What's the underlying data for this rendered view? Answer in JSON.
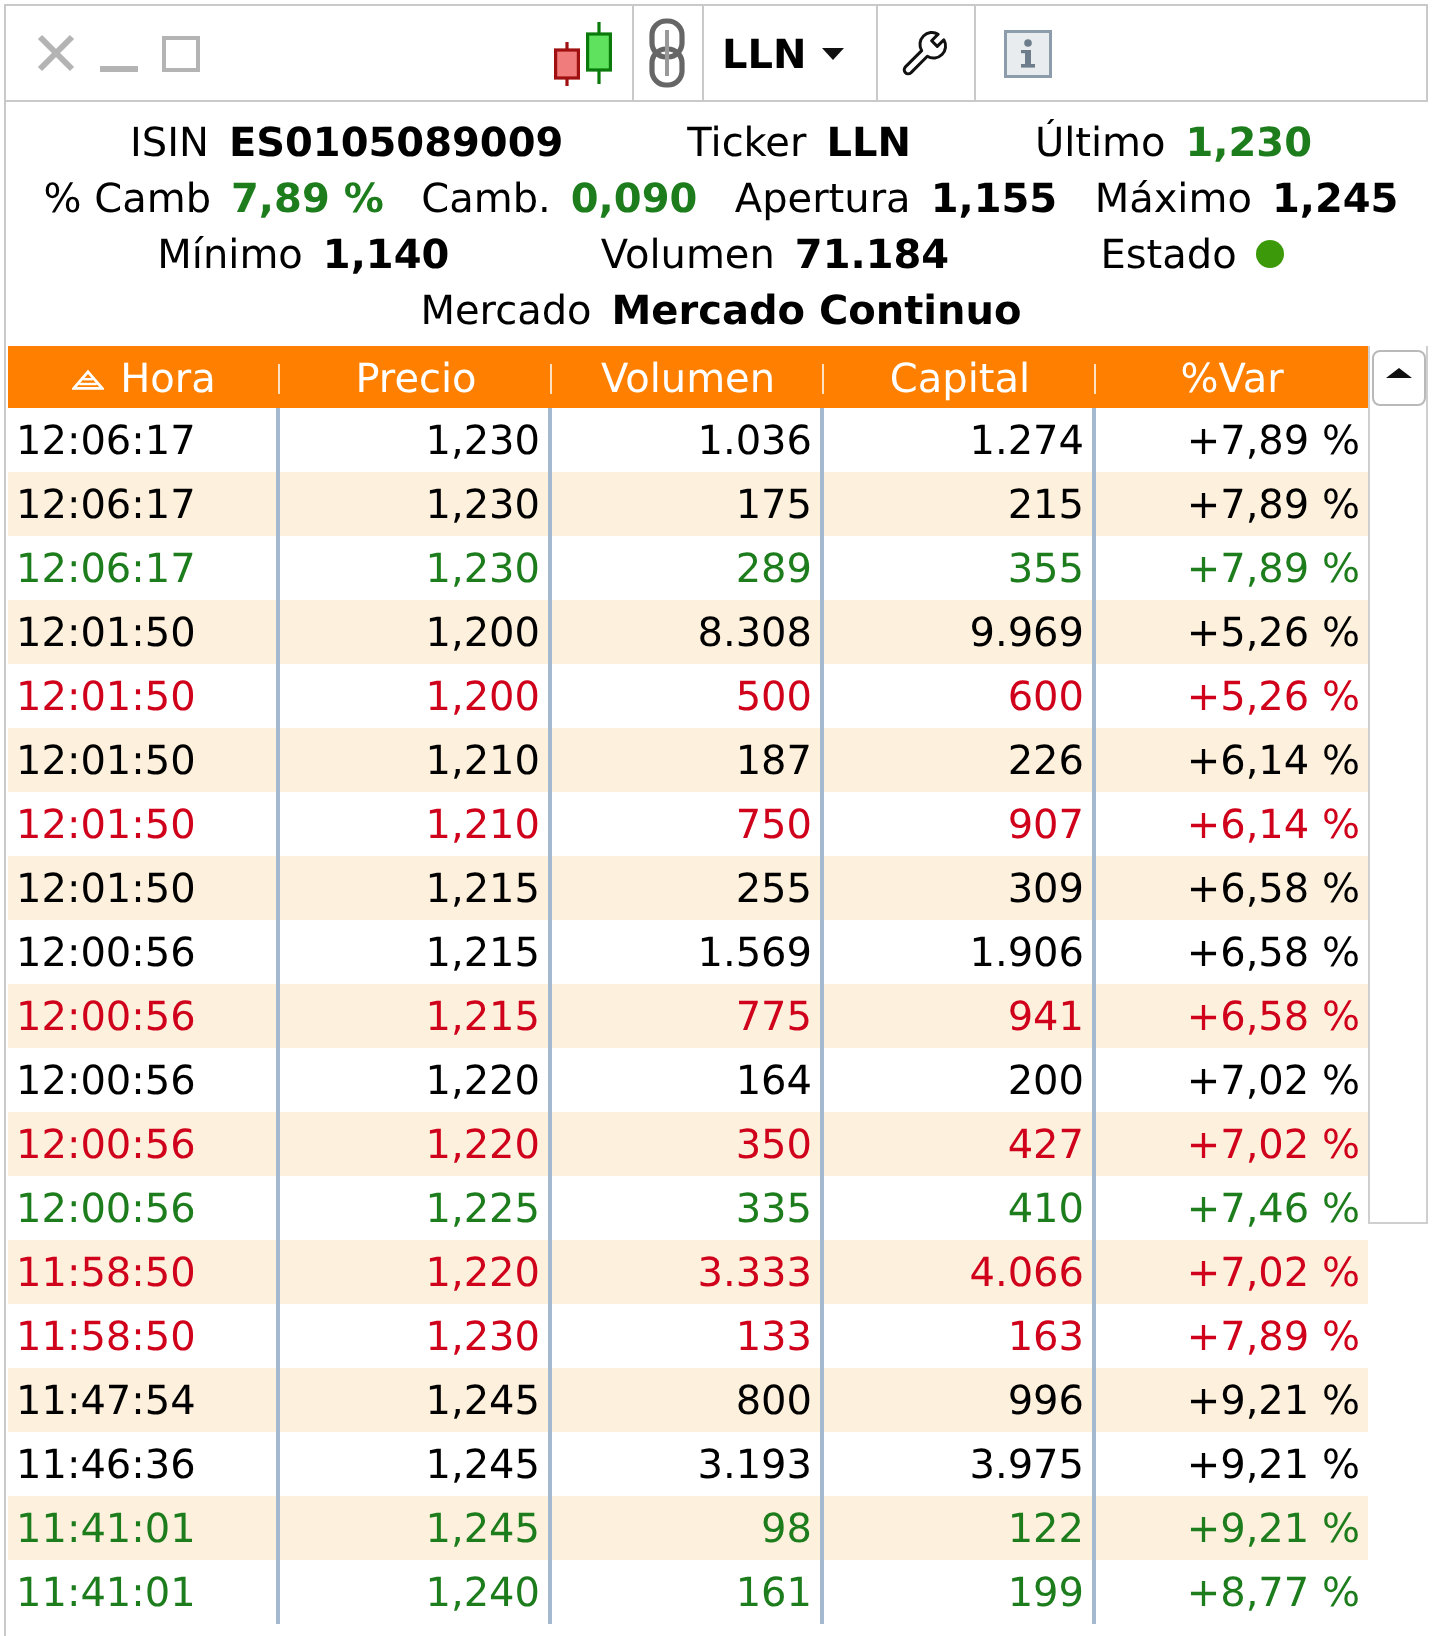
{
  "window_controls": [
    {
      "kind": "close",
      "disabled": true
    },
    {
      "kind": "minimize",
      "disabled": true
    },
    {
      "kind": "maximize",
      "disabled": true
    }
  ],
  "ticker_dropdown": {
    "value": "LLN"
  },
  "summary": [
    {
      "fields": [
        {
          "kind": "value",
          "label": "ISIN",
          "value": "ES0105089009",
          "color": "#000000"
        },
        {
          "kind": "value",
          "label": "Ticker",
          "value": "LLN",
          "color": "#000000"
        },
        {
          "kind": "value",
          "label": "Último",
          "value": "1,230",
          "color": "#1d7d1d"
        }
      ]
    },
    {
      "fields": [
        {
          "kind": "value",
          "label": "% Camb",
          "value": "7,89 %",
          "color": "#1d7d1d"
        },
        {
          "kind": "value",
          "label": "Camb.",
          "value": "0,090",
          "color": "#1d7d1d"
        },
        {
          "kind": "value",
          "label": "Apertura",
          "value": "1,155",
          "color": "#000000"
        },
        {
          "kind": "value",
          "label": "Máximo",
          "value": "1,245",
          "color": "#000000"
        }
      ]
    },
    {
      "fields": [
        {
          "kind": "value",
          "label": "Mínimo",
          "value": "1,140",
          "color": "#000000"
        },
        {
          "kind": "value",
          "label": "Volumen",
          "value": "71.184",
          "color": "#000000"
        },
        {
          "kind": "status",
          "label": "Estado",
          "color": "#3c9a0a"
        }
      ]
    },
    {
      "fields": [
        {
          "kind": "value",
          "label": "Mercado",
          "value": "Mercado Continuo",
          "color": "#000000"
        }
      ]
    }
  ],
  "table": {
    "columns": [
      {
        "label": "Hora",
        "sorted": true
      },
      {
        "label": "Precio",
        "sorted": false
      },
      {
        "label": "Volumen",
        "sorted": false
      },
      {
        "label": "Capital",
        "sorted": false
      },
      {
        "label": "%Var",
        "sorted": false
      }
    ],
    "rows": [
      {
        "cells": [
          "12:06:17",
          "1,230",
          "1.036",
          "1.274",
          "+7,89 %"
        ],
        "color": "#000000"
      },
      {
        "cells": [
          "12:06:17",
          "1,230",
          "175",
          "215",
          "+7,89 %"
        ],
        "color": "#000000"
      },
      {
        "cells": [
          "12:06:17",
          "1,230",
          "289",
          "355",
          "+7,89 %"
        ],
        "color": "#1d7d1d"
      },
      {
        "cells": [
          "12:01:50",
          "1,200",
          "8.308",
          "9.969",
          "+5,26 %"
        ],
        "color": "#000000"
      },
      {
        "cells": [
          "12:01:50",
          "1,200",
          "500",
          "600",
          "+5,26 %"
        ],
        "color": "#d0021b"
      },
      {
        "cells": [
          "12:01:50",
          "1,210",
          "187",
          "226",
          "+6,14 %"
        ],
        "color": "#000000"
      },
      {
        "cells": [
          "12:01:50",
          "1,210",
          "750",
          "907",
          "+6,14 %"
        ],
        "color": "#d0021b"
      },
      {
        "cells": [
          "12:01:50",
          "1,215",
          "255",
          "309",
          "+6,58 %"
        ],
        "color": "#000000"
      },
      {
        "cells": [
          "12:00:56",
          "1,215",
          "1.569",
          "1.906",
          "+6,58 %"
        ],
        "color": "#000000"
      },
      {
        "cells": [
          "12:00:56",
          "1,215",
          "775",
          "941",
          "+6,58 %"
        ],
        "color": "#d0021b"
      },
      {
        "cells": [
          "12:00:56",
          "1,220",
          "164",
          "200",
          "+7,02 %"
        ],
        "color": "#000000"
      },
      {
        "cells": [
          "12:00:56",
          "1,220",
          "350",
          "427",
          "+7,02 %"
        ],
        "color": "#d0021b"
      },
      {
        "cells": [
          "12:00:56",
          "1,225",
          "335",
          "410",
          "+7,46 %"
        ],
        "color": "#1d7d1d"
      },
      {
        "cells": [
          "11:58:50",
          "1,220",
          "3.333",
          "4.066",
          "+7,02 %"
        ],
        "color": "#d0021b"
      },
      {
        "cells": [
          "11:58:50",
          "1,230",
          "133",
          "163",
          "+7,89 %"
        ],
        "color": "#d0021b"
      },
      {
        "cells": [
          "11:47:54",
          "1,245",
          "800",
          "996",
          "+9,21 %"
        ],
        "color": "#000000"
      },
      {
        "cells": [
          "11:46:36",
          "1,245",
          "3.193",
          "3.975",
          "+9,21 %"
        ],
        "color": "#000000"
      },
      {
        "cells": [
          "11:41:01",
          "1,245",
          "98",
          "122",
          "+9,21 %"
        ],
        "color": "#1d7d1d"
      },
      {
        "cells": [
          "11:41:01",
          "1,240",
          "161",
          "199",
          "+8,77 %"
        ],
        "color": "#1d7d1d"
      }
    ]
  }
}
